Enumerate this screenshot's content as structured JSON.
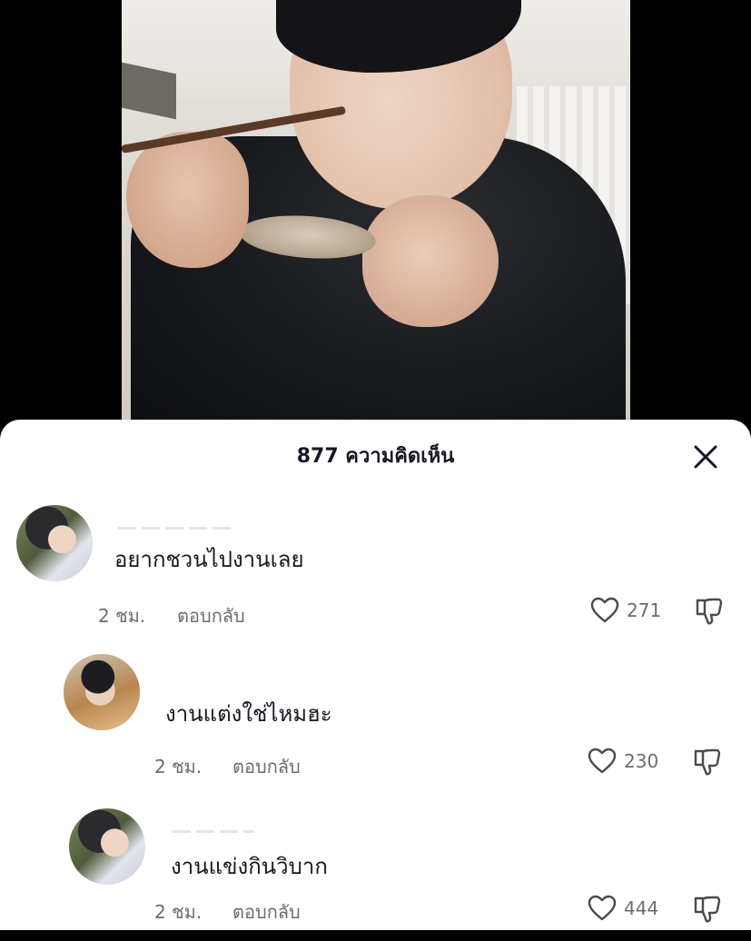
{
  "media": {
    "icon": "photo-person-eating"
  },
  "sheet": {
    "title": "877 ความคิดเห็น",
    "close_icon": "close-icon"
  },
  "comments": [
    {
      "text": "อยากชวนไปงานเลย",
      "time": "2 ชม.",
      "reply_label": "ตอบกลับ",
      "likes": "271",
      "is_reply": false
    },
    {
      "text": "งานแต่งใช่ไหมฮะ",
      "time": "2 ชม.",
      "reply_label": "ตอบกลับ",
      "likes": "230",
      "is_reply": true
    },
    {
      "text": "งานแข่งกินวิบาก",
      "time": "2 ชม.",
      "reply_label": "ตอบกลับ",
      "likes": "444",
      "is_reply": true
    }
  ],
  "colors": {
    "sheet_bg": "#ffffff",
    "text_primary": "#161823",
    "text_secondary": "#6c6c70"
  }
}
